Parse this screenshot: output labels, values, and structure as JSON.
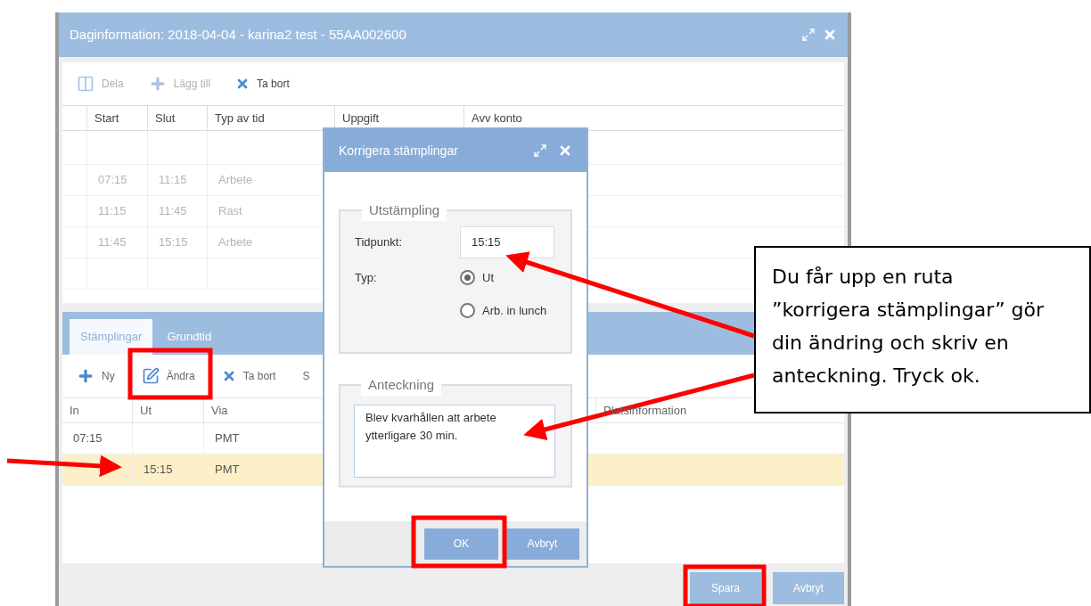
{
  "window": {
    "title": "Daginformation: 2018-04-04 - karina2 test - 55AA002600"
  },
  "day_toolbar": [
    {
      "kind": "split",
      "label": "Dela",
      "disabled": true
    },
    {
      "kind": "add",
      "label": "Lägg till",
      "disabled": true
    },
    {
      "kind": "remove",
      "label": "Ta bort",
      "disabled": false
    }
  ],
  "day_table": {
    "columns": [
      "Start",
      "Slut",
      "Typ av tid",
      "Uppgift",
      "Avv konto"
    ],
    "rows": [
      [
        "07:15",
        "11:15",
        "Arbete"
      ],
      [
        "11:15",
        "11:45",
        "Rast"
      ],
      [
        "11:45",
        "15:15",
        "Arbete"
      ]
    ]
  },
  "tabs": [
    {
      "label": "Stämplingar",
      "selected": true
    },
    {
      "label": "Grundtid",
      "selected": false
    }
  ],
  "stamp_toolbar": [
    {
      "kind": "add",
      "label": "Ny"
    },
    {
      "kind": "edit",
      "label": "Ändra"
    },
    {
      "kind": "remove",
      "label": "Ta bort"
    },
    {
      "kind": "cut",
      "label": "S"
    }
  ],
  "stamp_table": {
    "columns": [
      "In",
      "Ut",
      "Via",
      "Platsinformation"
    ],
    "rows": [
      {
        "cells": [
          "07:15",
          "",
          "PMT"
        ],
        "selected": false
      },
      {
        "cells": [
          "",
          "15:15",
          "PMT"
        ],
        "selected": true
      }
    ]
  },
  "footer_buttons": [
    "Spara",
    "Avbryt"
  ],
  "dialog": {
    "title": "Korrigera stämplingar",
    "punch_group": "Utstämpling",
    "time_label": "Tidpunkt:",
    "time_value": "15:15",
    "type_label": "Typ:",
    "types": [
      {
        "label": "Ut",
        "selected": true
      },
      {
        "label": "Arb. in lunch",
        "selected": false
      }
    ],
    "note_group": "Anteckning",
    "note": "Blev kvarhållen att arbete ytterligare 30 min.",
    "buttons": [
      "OK",
      "Avbryt"
    ]
  },
  "callout": "Du får upp en ruta ”korrigera stämplingar” gör din ändring och skriv en anteckning. Tryck ok."
}
